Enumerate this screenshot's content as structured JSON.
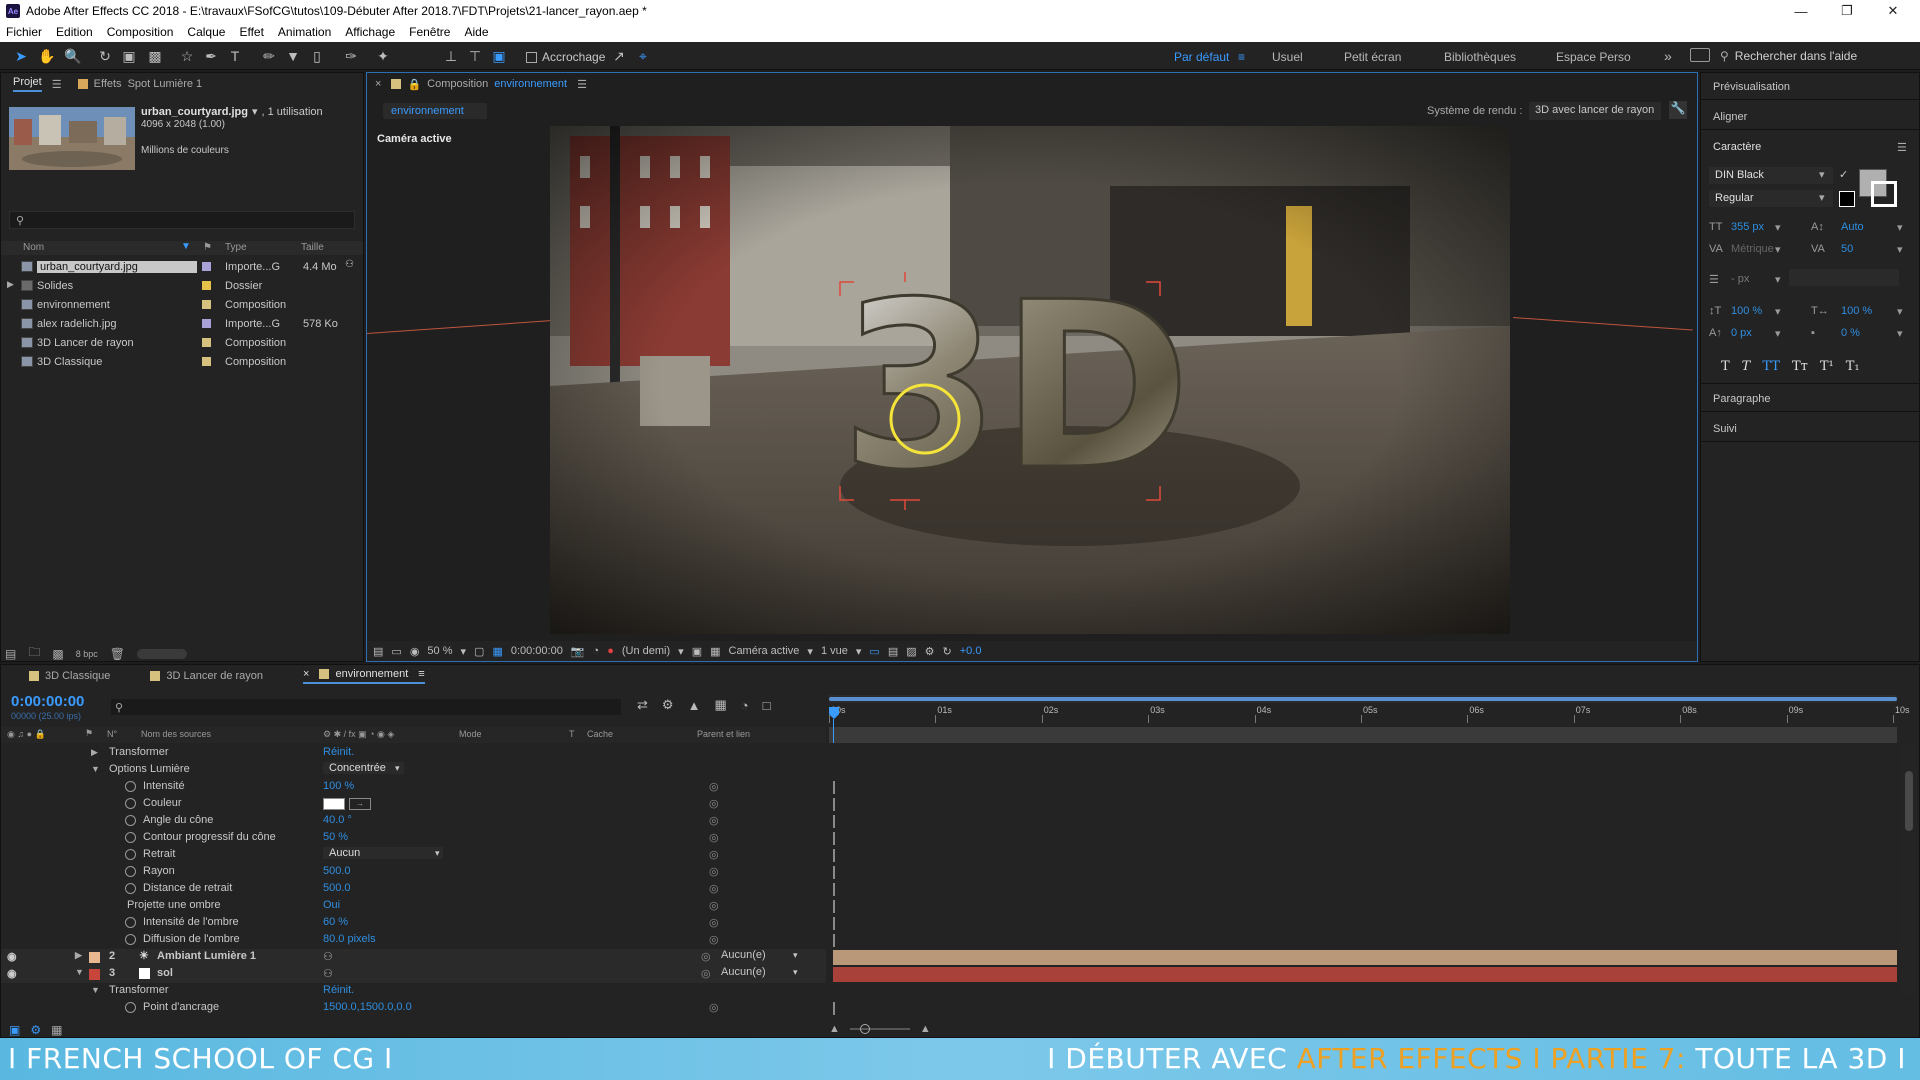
{
  "window": {
    "app_icon": "Ae",
    "title": "Adobe After Effects CC 2018 - E:\\travaux\\FSofCG\\tutos\\109-Débuter After 2018.7\\FDT\\Projets\\21-lancer_rayon.aep *",
    "controls": [
      "minimize-icon",
      "restore-icon",
      "close-icon"
    ]
  },
  "menu": [
    "Fichier",
    "Edition",
    "Composition",
    "Calque",
    "Effet",
    "Animation",
    "Affichage",
    "Fenêtre",
    "Aide"
  ],
  "toolbar": {
    "snapping_label": "Accrochage",
    "workspaces": [
      "Par défaut",
      "Usuel",
      "Petit écran",
      "Bibliothèques",
      "Espace Perso"
    ],
    "active_workspace": "Par défaut",
    "more": "»",
    "search_placeholder": "Rechercher dans l'aide"
  },
  "project_panel": {
    "tab_label": "Projet",
    "effects_tab_label": "Effets",
    "effects_target": "Spot Lumière 1",
    "preview_name": "urban_courtyard.jpg",
    "preview_usage": ", 1 utilisation",
    "preview_dims": "4096 x 2048 (1.00)",
    "preview_colors": "Millions de couleurs",
    "search_placeholder": "",
    "columns": [
      "Nom",
      "Type",
      "Taille"
    ],
    "items": [
      {
        "name": "urban_courtyard.jpg",
        "type": "Importe...G",
        "size": "4.4 Mo",
        "label_color": "#a8a2d9",
        "icon": "image-icon",
        "selected": true
      },
      {
        "name": "Solides",
        "type": "Dossier",
        "size": "",
        "label_color": "#e6c24b",
        "icon": "folder-icon",
        "selected": false
      },
      {
        "name": "environnement",
        "type": "Composition",
        "size": "",
        "label_color": "#d6c17f",
        "icon": "composition-icon",
        "selected": false
      },
      {
        "name": "alex radelich.jpg",
        "type": "Importe...G",
        "size": "578 Ko",
        "label_color": "#a8a2d9",
        "icon": "image-icon",
        "selected": false
      },
      {
        "name": "3D Lancer de rayon",
        "type": "Composition",
        "size": "",
        "label_color": "#d6c17f",
        "icon": "composition-icon",
        "selected": false
      },
      {
        "name": "3D Classique",
        "type": "Composition",
        "size": "",
        "label_color": "#d6c17f",
        "icon": "composition-icon",
        "selected": false
      }
    ],
    "bpc": "8 bpc"
  },
  "composition_panel": {
    "tab_prefix": "Composition",
    "tab_name": "environnement",
    "breadcrumb": "environnement",
    "renderer_label": "Système de rendu :",
    "renderer_value": "3D avec lancer de rayon",
    "camera_label": "Caméra active",
    "scene_text": "3D",
    "footer": {
      "zoom": "50 %",
      "timecode": "0:00:00:00",
      "resolution": "(Un demi)",
      "camera": "Caméra active",
      "views": "1 vue",
      "exposure": "+0.0"
    }
  },
  "right_panel": {
    "preview": "Prévisualisation",
    "align": "Aligner",
    "character": "Caractère",
    "font_family": "DIN Black",
    "font_style": "Regular",
    "font_size": "355 px",
    "leading": "Auto",
    "kerning": "Métrique",
    "tracking": "50",
    "stroke_width": "- px",
    "vscale": "100 %",
    "hscale": "100 %",
    "baseline": "0 px",
    "tsume": "0 %",
    "style_buttons": [
      "T",
      "T",
      "TT",
      "Tт",
      "T¹",
      "T₁"
    ],
    "paragraph": "Paragraphe",
    "tracker": "Suivi"
  },
  "timeline": {
    "tabs": [
      {
        "label": "3D Classique",
        "color": "#d6c17f",
        "active": false
      },
      {
        "label": "3D Lancer de rayon",
        "color": "#d6c17f",
        "active": false
      },
      {
        "label": "environnement",
        "color": "#d6c17f",
        "active": true
      }
    ],
    "timecode": "0:00:00:00",
    "fps": "00000 (25.00 ips)",
    "columns": {
      "num": "N°",
      "source": "Nom des sources",
      "mode": "Mode",
      "t": "T",
      "cache": "Cache",
      "parent": "Parent et lien"
    },
    "ruler": [
      "00s",
      "01s",
      "02s",
      "03s",
      "04s",
      "05s",
      "06s",
      "07s",
      "08s",
      "09s",
      "10s"
    ],
    "rows": [
      {
        "kind": "group",
        "indent": 1,
        "name": "Transformer",
        "value": "Réinit.",
        "open": false
      },
      {
        "kind": "group",
        "indent": 1,
        "name": "Options Lumière",
        "value": "Concentrée",
        "open": true,
        "dropdown": true
      },
      {
        "kind": "prop",
        "name": "Intensité",
        "value": "100 %"
      },
      {
        "kind": "prop",
        "name": "Couleur",
        "value": "",
        "color_swatch": "#ffffff"
      },
      {
        "kind": "prop",
        "name": "Angle du cône",
        "value": "40.0 °"
      },
      {
        "kind": "prop",
        "name": "Contour progressif du cône",
        "value": "50 %"
      },
      {
        "kind": "prop",
        "name": "Retrait",
        "value": "Aucun",
        "dropdown": true
      },
      {
        "kind": "prop",
        "name": "Rayon",
        "value": "500.0"
      },
      {
        "kind": "prop",
        "name": "Distance de retrait",
        "value": "500.0"
      },
      {
        "kind": "prop",
        "name": "Projette une ombre",
        "value": "Oui",
        "nostopwatch": true
      },
      {
        "kind": "prop",
        "name": "Intensité de l'ombre",
        "value": "60 %"
      },
      {
        "kind": "prop",
        "name": "Diffusion de l'ombre",
        "value": "80.0 pixels"
      }
    ],
    "layers": [
      {
        "num": "2",
        "name": "Ambiant Lumière 1",
        "label_color": "#e8b991",
        "parent": "Aucun(e)",
        "bar_color": "#b89878",
        "icon": "light-icon"
      },
      {
        "num": "3",
        "name": "sol",
        "label_color": "#c8453b",
        "parent": "Aucun(e)",
        "bar_color": "#a8413a",
        "icon": "solid-icon"
      }
    ],
    "after_rows": [
      {
        "kind": "group",
        "indent": 1,
        "name": "Transformer",
        "value": "Réinit.",
        "open": true
      },
      {
        "kind": "prop",
        "name": "Point d'ancrage",
        "value": "1500.0,1500.0,0.0"
      }
    ]
  },
  "banner": {
    "left": "I FRENCH SCHOOL OF CG I",
    "right_a": "I DÉBUTER AVEC ",
    "right_b": "AFTER EFFECTS I PARTIE 7:",
    "right_c": " TOUTE LA 3D I",
    "accent": "#f0a020"
  }
}
